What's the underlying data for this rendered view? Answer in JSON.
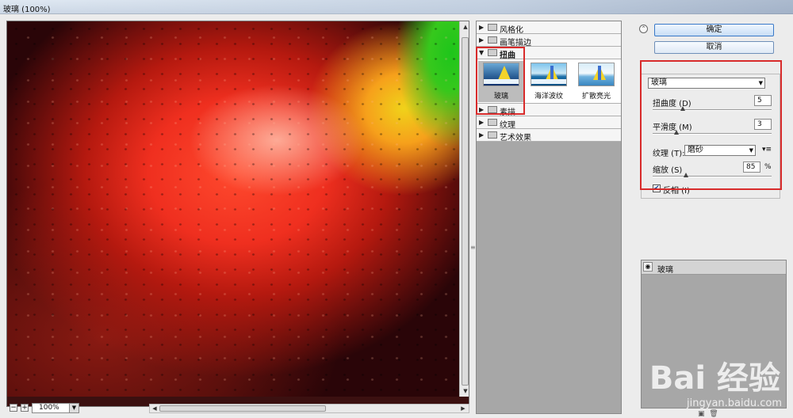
{
  "window": {
    "title": "玻璃 (100%)"
  },
  "preview": {
    "zoom": "100%"
  },
  "filters": {
    "categories": [
      {
        "label": "风格化",
        "open": false
      },
      {
        "label": "画笔描边",
        "open": false
      },
      {
        "label": "扭曲",
        "open": true
      },
      {
        "label": "素描",
        "open": false
      },
      {
        "label": "纹理",
        "open": false
      },
      {
        "label": "艺术效果",
        "open": false
      }
    ],
    "distort_items": [
      {
        "label": "玻璃",
        "selected": true
      },
      {
        "label": "海洋波纹",
        "selected": false
      },
      {
        "label": "扩散亮光",
        "selected": false
      }
    ]
  },
  "buttons": {
    "ok": "确定",
    "cancel": "取消"
  },
  "settings": {
    "filter_select": "玻璃",
    "distortion": {
      "label": "扭曲度 (D)",
      "value": "5",
      "fraction": 0.25
    },
    "smoothness": {
      "label": "平滑度 (M)",
      "value": "3",
      "fraction": 0.2
    },
    "texture": {
      "label": "纹理 (T):",
      "value": "磨砂"
    },
    "scaling": {
      "label": "缩放 (S)",
      "value": "85",
      "unit": "%",
      "fraction": 0.28
    },
    "invert": {
      "label": "反相 (I)",
      "checked": true
    }
  },
  "layers": {
    "items": [
      {
        "label": "玻璃"
      }
    ]
  },
  "watermark": {
    "brand": "Bai 经验",
    "url": "jingyan.baidu.com"
  }
}
